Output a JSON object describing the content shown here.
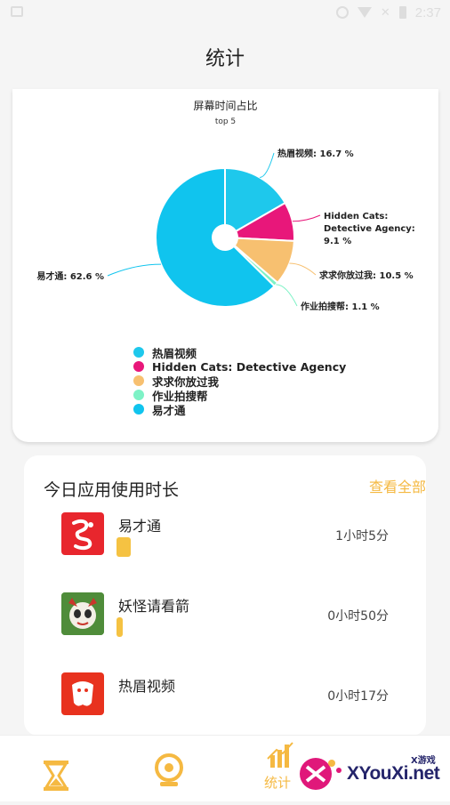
{
  "status_bar": {
    "time": "2:37"
  },
  "page_title": "统计",
  "chart_data": {
    "type": "pie",
    "title": "屏幕时间占比",
    "subtitle": "top 5",
    "slices": [
      {
        "label": "热眉视频",
        "value": 16.7,
        "display": "热眉视频: 16.7 %",
        "color": "#1ec8ec"
      },
      {
        "label": "Hidden Cats: Detective Agency",
        "value": 9.1,
        "display_lines": [
          "Hidden Cats:",
          "Detective Agency:",
          "9.1 %"
        ],
        "color": "#e8177a"
      },
      {
        "label": "求求你放过我",
        "value": 10.5,
        "display": "求求你放过我: 10.5 %",
        "color": "#f7c070"
      },
      {
        "label": "作业拍搜帮",
        "value": 1.1,
        "display": "作业拍搜帮: 1.1 %",
        "color": "#7ef2c6"
      },
      {
        "label": "易才通",
        "value": 62.6,
        "display": "易才通: 62.6 %",
        "color": "#10c4ee"
      }
    ],
    "legend_position": "bottom-left"
  },
  "usage": {
    "title": "今日应用使用时长",
    "view_all": "查看全部",
    "apps": [
      {
        "name": "易才通",
        "duration": "1小时5分",
        "bar_fraction": 1.0,
        "icon": "yicaitong-icon"
      },
      {
        "name": "妖怪请看箭",
        "duration": "0小时50分",
        "bar_fraction": 0.45,
        "icon": "yaoguai-game-icon"
      },
      {
        "name": "热眉视频",
        "duration": "0小时17分",
        "bar_fraction": 0.0,
        "icon": "remei-video-icon"
      }
    ]
  },
  "bottom_nav": {
    "items": [
      {
        "id": "timer",
        "icon": "hourglass-icon",
        "label": ""
      },
      {
        "id": "focus",
        "icon": "camera-icon",
        "label": ""
      },
      {
        "id": "stats",
        "icon": "bar-chart-icon",
        "label": "统计",
        "active": true
      }
    ]
  },
  "watermark": {
    "text": "XYouXi.net",
    "small": "X游戏"
  }
}
